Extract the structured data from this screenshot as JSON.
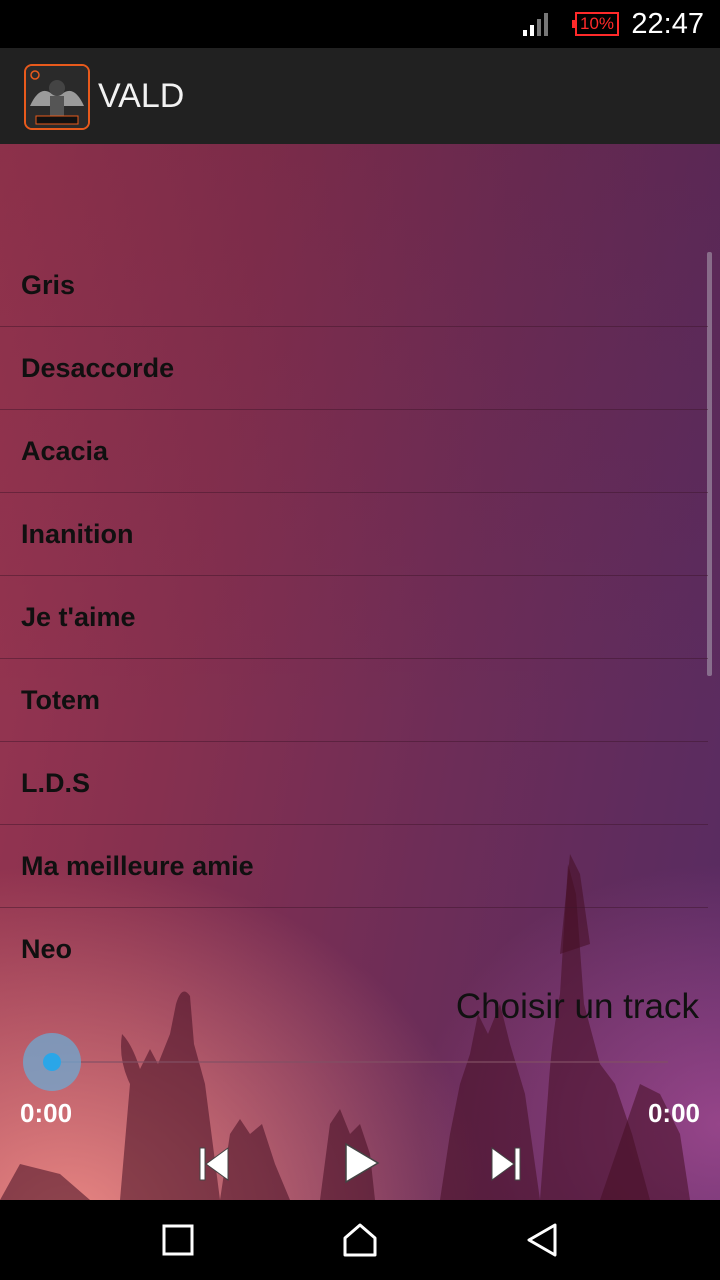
{
  "status_bar": {
    "battery": "10%",
    "time": "22:47",
    "battery_color": "#ff2a2a",
    "signal_icon": "cell-signal-icon",
    "battery_icon": "battery-low-icon"
  },
  "app_bar": {
    "title": "VALD",
    "icon": "app-logo-icon",
    "background": "#212121"
  },
  "tracks": [
    {
      "label": "Gris"
    },
    {
      "label": "Desaccorde"
    },
    {
      "label": "Acacia"
    },
    {
      "label": "Inanition"
    },
    {
      "label": "Je t'aime"
    },
    {
      "label": "Totem"
    },
    {
      "label": "L.D.S"
    },
    {
      "label": "Ma meilleure amie"
    },
    {
      "label": "Neo"
    }
  ],
  "player": {
    "now_playing": "Choisir un track",
    "current_time": "0:00",
    "total_time": "0:00",
    "progress": 0,
    "controls": [
      "previous-icon",
      "play-icon",
      "next-icon"
    ],
    "accent_color": "#2aa6e8"
  },
  "nav_bar": {
    "buttons": [
      "recent-apps-icon",
      "home-icon",
      "back-icon"
    ]
  }
}
